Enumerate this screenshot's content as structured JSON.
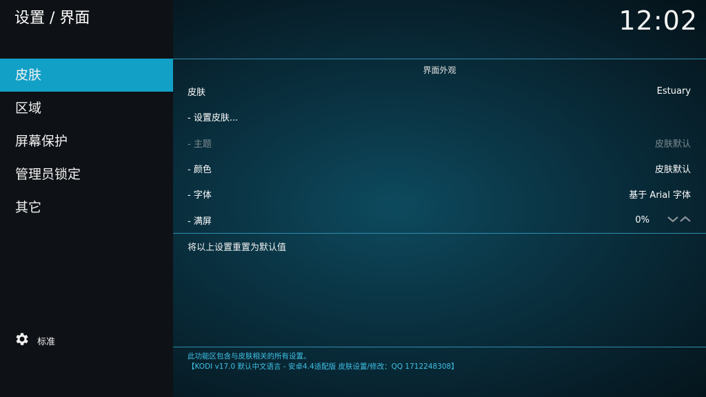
{
  "header": {
    "breadcrumb": "设置 / 界面",
    "clock": "12:02"
  },
  "sidebar": {
    "items": [
      {
        "label": "皮肤",
        "selected": true
      },
      {
        "label": "区域"
      },
      {
        "label": "屏幕保护"
      },
      {
        "label": "管理员锁定"
      },
      {
        "label": "其它"
      }
    ],
    "footer": {
      "icon": "gear-icon",
      "label": "标准"
    }
  },
  "main": {
    "section_title": "界面外观",
    "settings": [
      {
        "label": "皮肤",
        "value": "Estuary"
      },
      {
        "label": "- 设置皮肤...",
        "value": ""
      },
      {
        "label": "- 主题",
        "value": "皮肤默认",
        "disabled": true
      },
      {
        "label": "- 颜色",
        "value": "皮肤默认"
      },
      {
        "label": "- 字体",
        "value": "基于 Arial 字体"
      },
      {
        "label": "- 满屏",
        "value": "0%"
      }
    ],
    "reset_label": "将以上设置重置为默认值",
    "description": [
      "此功能区包含与皮肤相关的所有设置。",
      "【KODI v17.0 默认中文语言 - 安卓4.4适配版 皮肤设置/修改：QQ 1712248308】"
    ]
  },
  "colors": {
    "accent": "#12a0c7",
    "sidebar_bg": "#0e1115",
    "description_text": "#3fc1e6"
  }
}
